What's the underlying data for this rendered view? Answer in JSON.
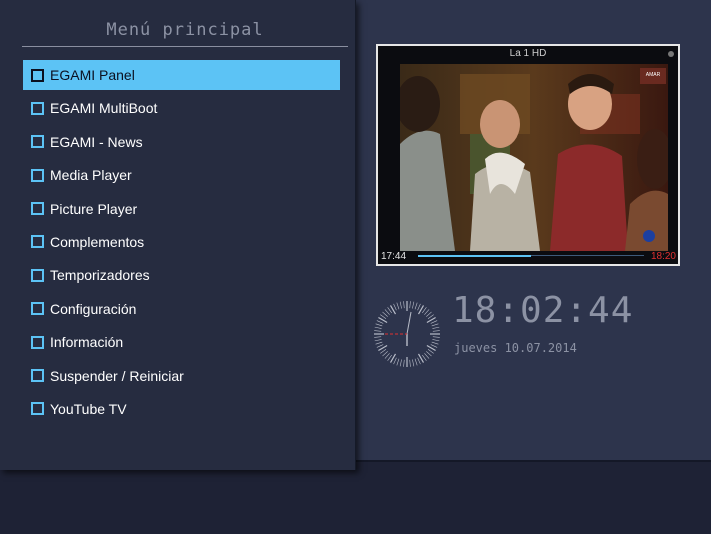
{
  "menu": {
    "title": "Menú principal",
    "selected_index": 0,
    "items": [
      {
        "label": "EGAMI Panel"
      },
      {
        "label": "EGAMI MultiBoot"
      },
      {
        "label": "EGAMI - News"
      },
      {
        "label": "Media Player"
      },
      {
        "label": "Picture Player"
      },
      {
        "label": "Complementos"
      },
      {
        "label": "Temporizadores"
      },
      {
        "label": "Configuración"
      },
      {
        "label": "Información"
      },
      {
        "label": "Suspender / Reiniciar"
      },
      {
        "label": "YouTube TV"
      }
    ]
  },
  "preview": {
    "channel": "La 1 HD",
    "time_start": "17:44",
    "time_end": "18:20",
    "progress": 0.5
  },
  "clock": {
    "time": "18:02:44",
    "date": "jueves 10.07.2014"
  },
  "colors": {
    "accent": "#5cc3f5",
    "end_time": "#e03030",
    "clock_text": "#8c92a4"
  }
}
